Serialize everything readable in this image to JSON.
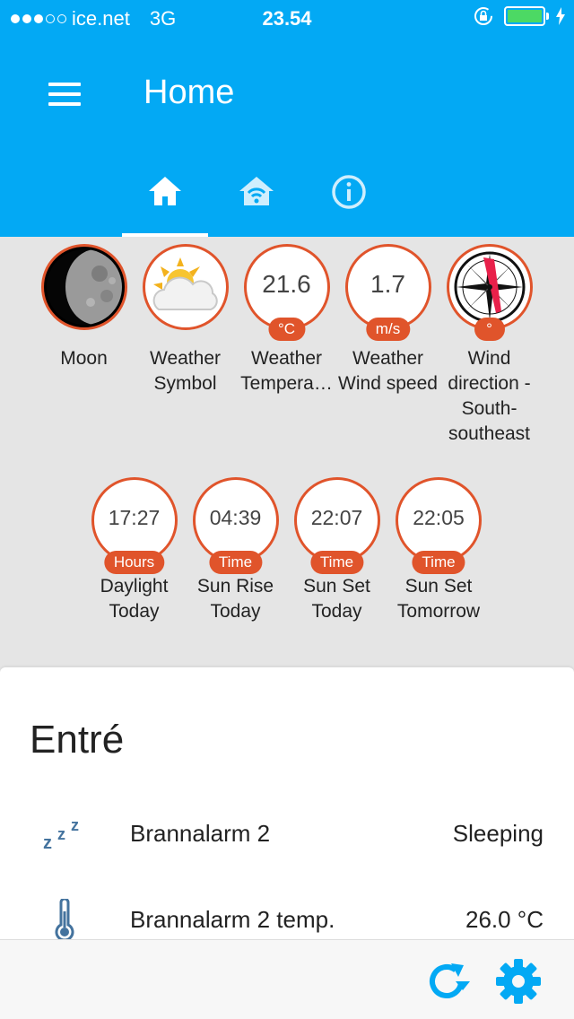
{
  "status": {
    "carrier": "ice.net",
    "network": "3G",
    "time": "23.54",
    "signal_bars_full": 3,
    "signal_bars_total": 5,
    "battery_level": 1.0
  },
  "header": {
    "title": "Home",
    "tabs": [
      {
        "name": "home",
        "icon": "home-icon",
        "active": true
      },
      {
        "name": "network",
        "icon": "router-icon",
        "active": false
      },
      {
        "name": "info",
        "icon": "info-icon",
        "active": false
      }
    ]
  },
  "tiles_row1": [
    {
      "label": "Moon",
      "icon": "moon-icon"
    },
    {
      "label": "Weather Symbol",
      "icon": "cloud-sun-icon"
    },
    {
      "label": "Weather Tempera…",
      "value": "21.6",
      "unit": "°C"
    },
    {
      "label": "Weather Wind speed",
      "value": "1.7",
      "unit": "m/s"
    },
    {
      "label": "Wind direction - South-southeast",
      "icon": "compass-icon",
      "unit": "°"
    }
  ],
  "tiles_row2": [
    {
      "label": "Daylight Today",
      "value": "17:27",
      "unit": "Hours"
    },
    {
      "label": "Sun Rise Today",
      "value": "04:39",
      "unit": "Time"
    },
    {
      "label": "Sun Set Today",
      "value": "22:07",
      "unit": "Time"
    },
    {
      "label": "Sun Set Tomorrow",
      "value": "22:05",
      "unit": "Time"
    }
  ],
  "card": {
    "title": "Entré",
    "entities": [
      {
        "name": "Brannalarm 2",
        "state": "Sleeping",
        "icon": "sleep-icon"
      },
      {
        "name": "Brannalarm 2 temp.",
        "state": "26.0 °C",
        "icon": "thermometer-icon"
      }
    ]
  },
  "colors": {
    "primary": "#03a9f4",
    "accent": "#e0542b",
    "icon": "#44739e"
  }
}
